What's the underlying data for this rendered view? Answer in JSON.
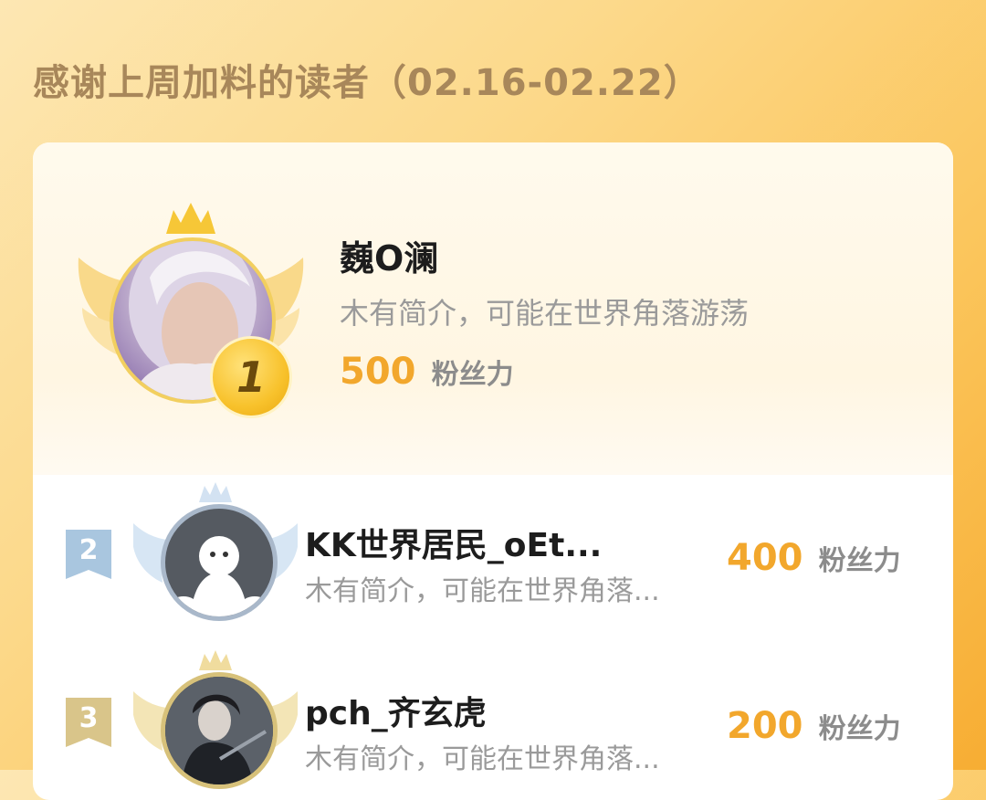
{
  "section_title": "感谢上周加料的读者（02.16-02.22）",
  "accent_color": "#f2a72c",
  "score_unit": "粉丝力",
  "top_reader": {
    "rank": "1",
    "name": "巍O澜",
    "bio": "木有简介，可能在世界角落游荡",
    "score": "500"
  },
  "readers": [
    {
      "rank": "2",
      "name": "KK世界居民_oEt...",
      "bio": "木有简介，可能在世界角落...",
      "score": "400"
    },
    {
      "rank": "3",
      "name": "pch_齐玄虎",
      "bio": "木有简介，可能在世界角落...",
      "score": "200"
    }
  ]
}
